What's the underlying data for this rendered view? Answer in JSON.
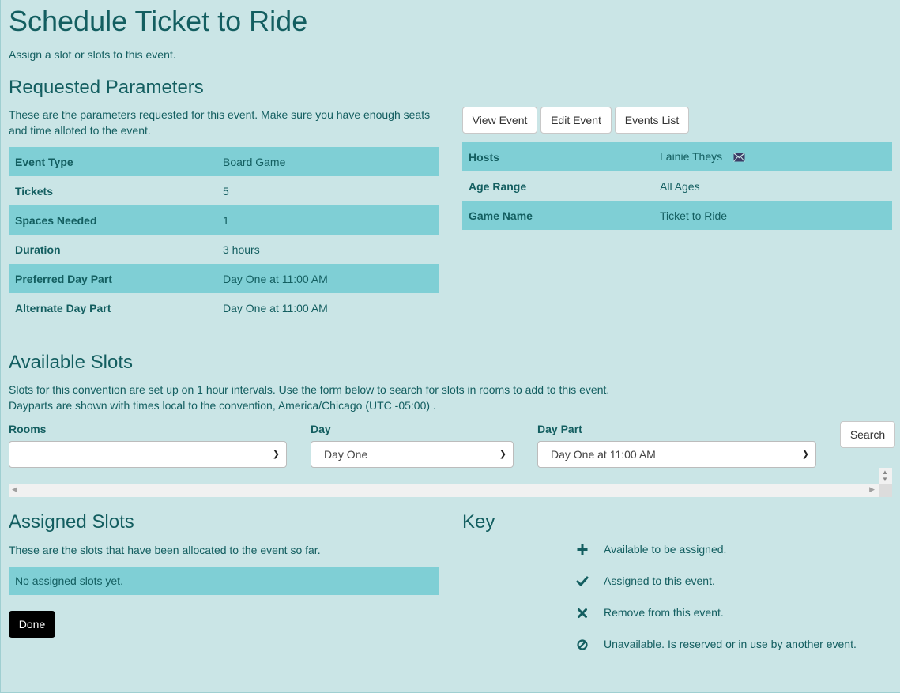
{
  "page": {
    "title": "Schedule Ticket to Ride",
    "subtitle": "Assign a slot or slots to this event."
  },
  "requested": {
    "heading": "Requested Parameters",
    "description": "These are the parameters requested for this event. Make sure you have enough seats and time alloted to the event.",
    "rows": [
      {
        "label": "Event Type",
        "value": "Board Game"
      },
      {
        "label": "Tickets",
        "value": "5"
      },
      {
        "label": "Spaces Needed",
        "value": "1"
      },
      {
        "label": "Duration",
        "value": "3 hours"
      },
      {
        "label": "Preferred Day Part",
        "value": "Day One at 11:00 AM"
      },
      {
        "label": "Alternate Day Part",
        "value": "Day One at 11:00 AM"
      }
    ]
  },
  "actions": {
    "view_event": "View Event",
    "edit_event": "Edit Event",
    "events_list": "Events List"
  },
  "info": {
    "rows": [
      {
        "label": "Hosts",
        "value": "Lainie Theys"
      },
      {
        "label": "Age Range",
        "value": "All Ages"
      },
      {
        "label": "Game Name",
        "value": "Ticket to Ride"
      }
    ],
    "host_icon": "envelope-icon"
  },
  "available": {
    "heading": "Available Slots",
    "line1": "Slots for this convention are set up on 1 hour intervals. Use the form below to search for slots in rooms to add to this event.",
    "line2": "Dayparts are shown with times local to the convention, America/Chicago (UTC -05:00) .",
    "rooms_label": "Rooms",
    "rooms_value": "",
    "day_label": "Day",
    "day_value": "Day One",
    "daypart_label": "Day Part",
    "daypart_value": "Day One at 11:00 AM",
    "search_label": "Search"
  },
  "assigned": {
    "heading": "Assigned Slots",
    "description": "These are the slots that have been allocated to the event so far.",
    "empty": "No assigned slots yet.",
    "done_label": "Done"
  },
  "key": {
    "heading": "Key",
    "items": [
      {
        "icon": "plus-icon",
        "text": "Available to be assigned."
      },
      {
        "icon": "check-icon",
        "text": "Assigned to this event."
      },
      {
        "icon": "cross-icon",
        "text": "Remove from this event."
      },
      {
        "icon": "ban-icon",
        "text": "Unavailable. Is reserved or in use by another event."
      }
    ]
  },
  "colors": {
    "background": "#cae5e6",
    "accent_row": "#7fcfd5",
    "text": "#135e60"
  }
}
